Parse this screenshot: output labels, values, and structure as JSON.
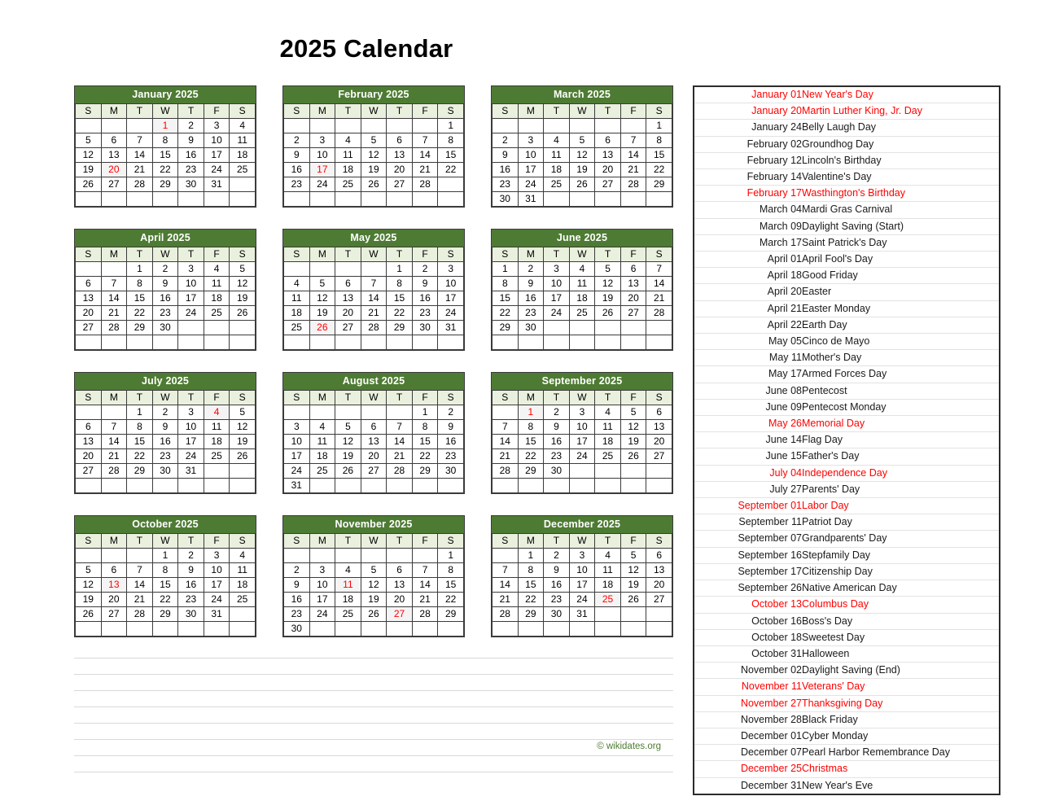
{
  "page": {
    "title": "2025 Calendar",
    "credit": "© wikidates.org",
    "accent_green": "#4e7b33",
    "weekday_bg": "#e9f0dd",
    "holiday_red": "#ff0000",
    "notes_line_count": 8
  },
  "weekday_labels": [
    "S",
    "M",
    "T",
    "W",
    "T",
    "F",
    "S"
  ],
  "months": [
    {
      "name": "January 2025",
      "weeks": [
        [
          "",
          "",
          "",
          "1",
          "2",
          "3",
          "4"
        ],
        [
          "5",
          "6",
          "7",
          "8",
          "9",
          "10",
          "11"
        ],
        [
          "12",
          "13",
          "14",
          "15",
          "16",
          "17",
          "18"
        ],
        [
          "19",
          "20",
          "21",
          "22",
          "23",
          "24",
          "25"
        ],
        [
          "26",
          "27",
          "28",
          "29",
          "30",
          "31",
          ""
        ],
        [
          "",
          "",
          "",
          "",
          "",
          "",
          ""
        ]
      ],
      "highlighted": [
        "1",
        "20"
      ]
    },
    {
      "name": "February 2025",
      "weeks": [
        [
          "",
          "",
          "",
          "",
          "",
          "",
          "1"
        ],
        [
          "2",
          "3",
          "4",
          "5",
          "6",
          "7",
          "8"
        ],
        [
          "9",
          "10",
          "11",
          "12",
          "13",
          "14",
          "15"
        ],
        [
          "16",
          "17",
          "18",
          "19",
          "20",
          "21",
          "22"
        ],
        [
          "23",
          "24",
          "25",
          "26",
          "27",
          "28",
          ""
        ],
        [
          "",
          "",
          "",
          "",
          "",
          "",
          ""
        ]
      ],
      "highlighted": [
        "17"
      ]
    },
    {
      "name": "March 2025",
      "weeks": [
        [
          "",
          "",
          "",
          "",
          "",
          "",
          "1"
        ],
        [
          "2",
          "3",
          "4",
          "5",
          "6",
          "7",
          "8"
        ],
        [
          "9",
          "10",
          "11",
          "12",
          "13",
          "14",
          "15"
        ],
        [
          "16",
          "17",
          "18",
          "19",
          "20",
          "21",
          "22"
        ],
        [
          "23",
          "24",
          "25",
          "26",
          "27",
          "28",
          "29"
        ],
        [
          "30",
          "31",
          "",
          "",
          "",
          "",
          ""
        ]
      ],
      "highlighted": []
    },
    {
      "name": "April 2025",
      "weeks": [
        [
          "",
          "",
          "1",
          "2",
          "3",
          "4",
          "5"
        ],
        [
          "6",
          "7",
          "8",
          "9",
          "10",
          "11",
          "12"
        ],
        [
          "13",
          "14",
          "15",
          "16",
          "17",
          "18",
          "19"
        ],
        [
          "20",
          "21",
          "22",
          "23",
          "24",
          "25",
          "26"
        ],
        [
          "27",
          "28",
          "29",
          "30",
          "",
          "",
          ""
        ],
        [
          "",
          "",
          "",
          "",
          "",
          "",
          ""
        ]
      ],
      "highlighted": []
    },
    {
      "name": "May 2025",
      "weeks": [
        [
          "",
          "",
          "",
          "",
          "1",
          "2",
          "3"
        ],
        [
          "4",
          "5",
          "6",
          "7",
          "8",
          "9",
          "10"
        ],
        [
          "11",
          "12",
          "13",
          "14",
          "15",
          "16",
          "17"
        ],
        [
          "18",
          "19",
          "20",
          "21",
          "22",
          "23",
          "24"
        ],
        [
          "25",
          "26",
          "27",
          "28",
          "29",
          "30",
          "31"
        ],
        [
          "",
          "",
          "",
          "",
          "",
          "",
          ""
        ]
      ],
      "highlighted": [
        "26"
      ]
    },
    {
      "name": "June 2025",
      "weeks": [
        [
          "1",
          "2",
          "3",
          "4",
          "5",
          "6",
          "7"
        ],
        [
          "8",
          "9",
          "10",
          "11",
          "12",
          "13",
          "14"
        ],
        [
          "15",
          "16",
          "17",
          "18",
          "19",
          "20",
          "21"
        ],
        [
          "22",
          "23",
          "24",
          "25",
          "26",
          "27",
          "28"
        ],
        [
          "29",
          "30",
          "",
          "",
          "",
          "",
          ""
        ],
        [
          "",
          "",
          "",
          "",
          "",
          "",
          ""
        ]
      ],
      "highlighted": []
    },
    {
      "name": "July 2025",
      "weeks": [
        [
          "",
          "",
          "1",
          "2",
          "3",
          "4",
          "5"
        ],
        [
          "6",
          "7",
          "8",
          "9",
          "10",
          "11",
          "12"
        ],
        [
          "13",
          "14",
          "15",
          "16",
          "17",
          "18",
          "19"
        ],
        [
          "20",
          "21",
          "22",
          "23",
          "24",
          "25",
          "26"
        ],
        [
          "27",
          "28",
          "29",
          "30",
          "31",
          "",
          ""
        ],
        [
          "",
          "",
          "",
          "",
          "",
          "",
          ""
        ]
      ],
      "highlighted": [
        "4"
      ]
    },
    {
      "name": "August 2025",
      "weeks": [
        [
          "",
          "",
          "",
          "",
          "",
          "1",
          "2"
        ],
        [
          "3",
          "4",
          "5",
          "6",
          "7",
          "8",
          "9"
        ],
        [
          "10",
          "11",
          "12",
          "13",
          "14",
          "15",
          "16"
        ],
        [
          "17",
          "18",
          "19",
          "20",
          "21",
          "22",
          "23"
        ],
        [
          "24",
          "25",
          "26",
          "27",
          "28",
          "29",
          "30"
        ],
        [
          "31",
          "",
          "",
          "",
          "",
          "",
          ""
        ]
      ],
      "highlighted": []
    },
    {
      "name": "September 2025",
      "weeks": [
        [
          "",
          "1",
          "2",
          "3",
          "4",
          "5",
          "6"
        ],
        [
          "7",
          "8",
          "9",
          "10",
          "11",
          "12",
          "13"
        ],
        [
          "14",
          "15",
          "16",
          "17",
          "18",
          "19",
          "20"
        ],
        [
          "21",
          "22",
          "23",
          "24",
          "25",
          "26",
          "27"
        ],
        [
          "28",
          "29",
          "30",
          "",
          "",
          "",
          ""
        ],
        [
          "",
          "",
          "",
          "",
          "",
          "",
          ""
        ]
      ],
      "highlighted": [
        "1"
      ]
    },
    {
      "name": "October 2025",
      "weeks": [
        [
          "",
          "",
          "",
          "1",
          "2",
          "3",
          "4"
        ],
        [
          "5",
          "6",
          "7",
          "8",
          "9",
          "10",
          "11"
        ],
        [
          "12",
          "13",
          "14",
          "15",
          "16",
          "17",
          "18"
        ],
        [
          "19",
          "20",
          "21",
          "22",
          "23",
          "24",
          "25"
        ],
        [
          "26",
          "27",
          "28",
          "29",
          "30",
          "31",
          ""
        ],
        [
          "",
          "",
          "",
          "",
          "",
          "",
          ""
        ]
      ],
      "highlighted": [
        "13"
      ]
    },
    {
      "name": "November 2025",
      "weeks": [
        [
          "",
          "",
          "",
          "",
          "",
          "",
          "1"
        ],
        [
          "2",
          "3",
          "4",
          "5",
          "6",
          "7",
          "8"
        ],
        [
          "9",
          "10",
          "11",
          "12",
          "13",
          "14",
          "15"
        ],
        [
          "16",
          "17",
          "18",
          "19",
          "20",
          "21",
          "22"
        ],
        [
          "23",
          "24",
          "25",
          "26",
          "27",
          "28",
          "29"
        ],
        [
          "30",
          "",
          "",
          "",
          "",
          "",
          ""
        ]
      ],
      "highlighted": [
        "11",
        "27"
      ]
    },
    {
      "name": "December 2025",
      "weeks": [
        [
          "",
          "1",
          "2",
          "3",
          "4",
          "5",
          "6"
        ],
        [
          "7",
          "8",
          "9",
          "10",
          "11",
          "12",
          "13"
        ],
        [
          "14",
          "15",
          "16",
          "17",
          "18",
          "19",
          "20"
        ],
        [
          "21",
          "22",
          "23",
          "24",
          "25",
          "26",
          "27"
        ],
        [
          "28",
          "29",
          "30",
          "31",
          "",
          "",
          ""
        ],
        [
          "",
          "",
          "",
          "",
          "",
          "",
          ""
        ]
      ],
      "highlighted": [
        "25"
      ]
    }
  ],
  "holidays": [
    {
      "date": "January 01",
      "name": "New Year's Day",
      "federal": true
    },
    {
      "date": "January 20",
      "name": "Martin Luther King, Jr. Day",
      "federal": true
    },
    {
      "date": "January 24",
      "name": "Belly Laugh Day",
      "federal": false
    },
    {
      "date": "February 02",
      "name": "Groundhog Day",
      "federal": false
    },
    {
      "date": "February 12",
      "name": "Lincoln's Birthday",
      "federal": false
    },
    {
      "date": "February 14",
      "name": "Valentine's Day",
      "federal": false
    },
    {
      "date": "February 17",
      "name": "Wasthington's Birthday",
      "federal": true
    },
    {
      "date": "March 04",
      "name": "Mardi Gras Carnival",
      "federal": false
    },
    {
      "date": "March 09",
      "name": "Daylight Saving (Start)",
      "federal": false
    },
    {
      "date": "March 17",
      "name": "Saint Patrick's Day",
      "federal": false
    },
    {
      "date": "April 01",
      "name": "April Fool's Day",
      "federal": false
    },
    {
      "date": "April 18",
      "name": "Good Friday",
      "federal": false
    },
    {
      "date": "April 20",
      "name": "Easter",
      "federal": false
    },
    {
      "date": "April 21",
      "name": "Easter Monday",
      "federal": false
    },
    {
      "date": "April 22",
      "name": "Earth Day",
      "federal": false
    },
    {
      "date": "May 05",
      "name": "Cinco de Mayo",
      "federal": false
    },
    {
      "date": "May 11",
      "name": "Mother's Day",
      "federal": false
    },
    {
      "date": "May 17",
      "name": "Armed Forces Day",
      "federal": false
    },
    {
      "date": "June 08",
      "name": "Pentecost",
      "federal": false
    },
    {
      "date": "June 09",
      "name": "Pentecost Monday",
      "federal": false
    },
    {
      "date": "May 26",
      "name": "Memorial Day",
      "federal": true
    },
    {
      "date": "June 14",
      "name": "Flag Day",
      "federal": false
    },
    {
      "date": "June 15",
      "name": "Father's Day",
      "federal": false
    },
    {
      "date": "July 04",
      "name": "Independence Day",
      "federal": true
    },
    {
      "date": "July 27",
      "name": "Parents' Day",
      "federal": false
    },
    {
      "date": "September 01",
      "name": "Labor Day",
      "federal": true
    },
    {
      "date": "September 11",
      "name": "Patriot Day",
      "federal": false
    },
    {
      "date": "September 07",
      "name": "Grandparents' Day",
      "federal": false
    },
    {
      "date": "September 16",
      "name": "Stepfamily Day",
      "federal": false
    },
    {
      "date": "September 17",
      "name": "Citizenship Day",
      "federal": false
    },
    {
      "date": "September 26",
      "name": "Native American Day",
      "federal": false
    },
    {
      "date": "October 13",
      "name": "Columbus Day",
      "federal": true
    },
    {
      "date": "October 16",
      "name": "Boss's Day",
      "federal": false
    },
    {
      "date": "October 18",
      "name": "Sweetest Day",
      "federal": false
    },
    {
      "date": "October 31",
      "name": "Halloween",
      "federal": false
    },
    {
      "date": "November 02",
      "name": "Daylight Saving (End)",
      "federal": false
    },
    {
      "date": "November 11",
      "name": "Veterans' Day",
      "federal": true
    },
    {
      "date": "November 27",
      "name": "Thanksgiving Day",
      "federal": true
    },
    {
      "date": "November 28",
      "name": "Black Friday",
      "federal": false
    },
    {
      "date": "December 01",
      "name": "Cyber Monday",
      "federal": false
    },
    {
      "date": "December 07",
      "name": "Pearl Harbor Remembrance Day",
      "federal": false
    },
    {
      "date": "December 25",
      "name": "Christmas",
      "federal": true
    },
    {
      "date": "December 31",
      "name": "New Year's Eve",
      "federal": false
    }
  ]
}
